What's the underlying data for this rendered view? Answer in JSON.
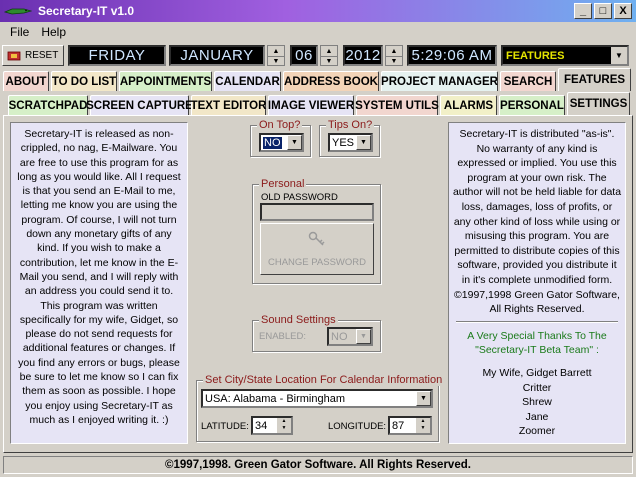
{
  "window": {
    "title": "Secretary-IT v1.0",
    "minimize": "_",
    "maximize": "□",
    "close": "X"
  },
  "menu": [
    "File",
    "Help"
  ],
  "toolbar": {
    "reset_label": "RESET",
    "day": "FRIDAY",
    "month": "JANUARY",
    "date": "06",
    "year": "2012",
    "time": "5:29:06 AM",
    "section_select": "FEATURES"
  },
  "main_tabs": [
    {
      "label": "ABOUT",
      "color": "#f2d6cf"
    },
    {
      "label": "TO DO LIST",
      "color": "#f2e7c8"
    },
    {
      "label": "APPOINTMENTS",
      "color": "#d6efc8"
    },
    {
      "label": "CALENDAR",
      "color": "#e6e4f5"
    },
    {
      "label": "ADDRESS BOOK",
      "color": "#f2d4b8"
    },
    {
      "label": "PROJECT MANAGER",
      "color": "#e6f2f0"
    },
    {
      "label": "SEARCH",
      "color": "#f2d6cf"
    },
    {
      "label": "FEATURES",
      "color": "#f2f0c8"
    }
  ],
  "sub_tabs": [
    {
      "label": "SCRATCHPAD",
      "color": "#d6efc8"
    },
    {
      "label": "SCREEN CAPTURE",
      "color": "#e6e4f5"
    },
    {
      "label": "TEXT EDITOR",
      "color": "#f2e7c8"
    },
    {
      "label": "IMAGE VIEWER",
      "color": "#e6e4f5"
    },
    {
      "label": "SYSTEM UTILS",
      "color": "#f2d6cf"
    },
    {
      "label": "ALARMS",
      "color": "#f2f0c8"
    },
    {
      "label": "PERSONAL",
      "color": "#d6efc8"
    },
    {
      "label": "SETTINGS",
      "color": "#d4d0c8"
    }
  ],
  "left_text": "Secretary-IT is released as non-crippled, no nag, E-Mailware. You are free to use this program for as long as you would like.  All I request is that you send an E-Mail to me, letting me know you are using the program.  Of course, I will not turn down any monetary gifts of any kind.  If you wish to make a contribution, let me know in the E-Mail you send, and I will reply with an address you could send it to.  This program was written specifically for my wife, Gidget, so please do not send requests for additional features or changes.  If you find any errors or bugs, please be sure to let me know so I can fix them as soon as possible.  I hope you enjoy using Secretary-IT as much as I enjoyed writing it.  :)",
  "right_text": "Secretary-IT is distributed \"as-is\".  No warranty of any kind is expressed or implied.  You use this program at your own risk.  The author will not be held liable for data loss, damages, loss of profits, or any other kind of loss while using or misusing this program.  You are permitted to distribute copies of this software, provided you distribute it in it's complete unmodified form. ©1997,1998 Green Gator Software, All Rights Reserved.",
  "thanks": {
    "heading": "A Very Special Thanks To The \"Secretary-IT Beta Team\" :",
    "names": [
      "My Wife, Gidget Barrett",
      "Critter",
      "Shrew",
      "Jane",
      "Zoomer"
    ]
  },
  "settings": {
    "on_top": {
      "label": "On Top?",
      "value": "NO"
    },
    "tips_on": {
      "label": "Tips On?",
      "value": "YES"
    },
    "personal": {
      "label": "Personal",
      "old_password_label": "OLD PASSWORD",
      "change_password": "CHANGE PASSWORD"
    },
    "sound": {
      "label": "Sound Settings",
      "enabled_label": "ENABLED:",
      "value": "NO"
    },
    "location": {
      "label": "Set City/State Location For Calendar Information",
      "city": "USA: Alabama - Birmingham",
      "latitude_label": "LATITUDE:",
      "latitude": "34",
      "longitude_label": "LONGITUDE:",
      "longitude": "87"
    }
  },
  "status": "©1997,1998.  Green Gator Software.  All Rights Reserved."
}
